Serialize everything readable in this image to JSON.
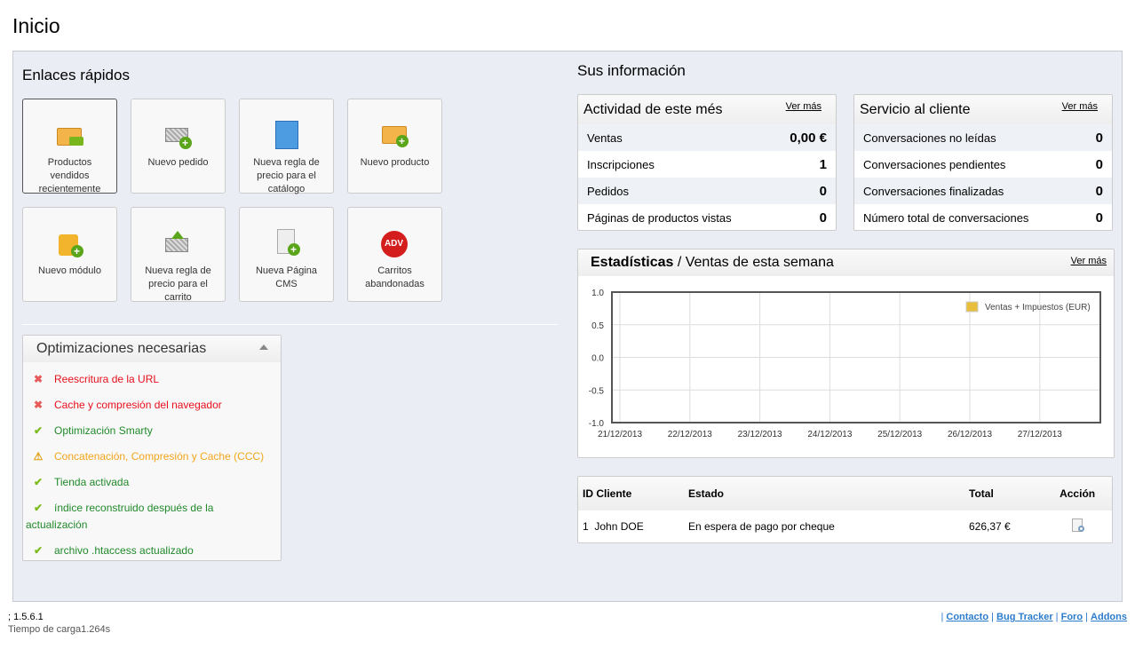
{
  "page_title": "Inicio",
  "quick_links": {
    "title": "Enlaces rápidos",
    "items": [
      {
        "label": "Productos vendidos recientemente",
        "icon": "box-arrow-icon"
      },
      {
        "label": "Nuevo pedido",
        "icon": "cart-add-icon"
      },
      {
        "label": "Nueva regla de precio para el catálogo",
        "icon": "book-icon"
      },
      {
        "label": "Nuevo producto",
        "icon": "box-add-icon"
      },
      {
        "label": "Nuevo módulo",
        "icon": "puzzle-add-icon"
      },
      {
        "label": "Nueva regla de precio para el carrito",
        "icon": "cart-up-icon"
      },
      {
        "label": "Nueva Página CMS",
        "icon": "page-add-icon"
      },
      {
        "label": "Carritos abandonadas",
        "icon": "adv-badge-icon",
        "badge": "ADV"
      }
    ]
  },
  "optimizations": {
    "title": "Optimizaciones necesarias",
    "items": [
      {
        "label": "Reescritura de la URL",
        "status": "error"
      },
      {
        "label": "Cache y compresión del navegador",
        "status": "error"
      },
      {
        "label": "Optimización Smarty",
        "status": "ok"
      },
      {
        "label": "Concatenación, Compresión y Cache (CCC)",
        "status": "warning"
      },
      {
        "label": "Tienda activada",
        "status": "ok"
      },
      {
        "label": "índice reconstruido después de la actualización",
        "status": "ok"
      },
      {
        "label": "archivo .htaccess actualizado",
        "status": "ok"
      }
    ]
  },
  "info": {
    "title": "Sus información",
    "activity": {
      "title": "Actividad de este més",
      "more": "Ver más",
      "rows": [
        {
          "label": "Ventas",
          "value": "0,00 €"
        },
        {
          "label": "Inscripciones",
          "value": "1"
        },
        {
          "label": "Pedidos",
          "value": "0"
        },
        {
          "label": "Páginas de productos vistas",
          "value": "0"
        }
      ]
    },
    "service": {
      "title": "Servicio al cliente",
      "more": "Ver más",
      "rows": [
        {
          "label": "Conversaciones no leídas",
          "value": "0"
        },
        {
          "label": "Conversaciones pendientes",
          "value": "0"
        },
        {
          "label": "Conversaciones finalizadas",
          "value": "0"
        },
        {
          "label": "Número total de conversaciones",
          "value": "0"
        }
      ]
    }
  },
  "stats": {
    "title_bold": "Estadísticas",
    "title_rest": " / Ventas de esta semana",
    "more": "Ver más"
  },
  "chart_data": {
    "type": "line",
    "title": "",
    "xlabel": "",
    "ylabel": "",
    "x_ticks": [
      "21/12/2013",
      "22/12/2013",
      "23/12/2013",
      "24/12/2013",
      "25/12/2013",
      "26/12/2013",
      "27/12/2013"
    ],
    "y_ticks": [
      "1.0",
      "0.5",
      "0.0",
      "-0.5",
      "-1.0"
    ],
    "ylim": [
      -1,
      1
    ],
    "grid": true,
    "legend": "top-right",
    "series": [
      {
        "name": "Ventas + Impuestos (EUR)",
        "color": "#e8bf3c",
        "values": []
      }
    ]
  },
  "orders": {
    "headers": [
      "ID Cliente",
      "Estado",
      "Total",
      "Acción"
    ],
    "rows": [
      {
        "id": "1",
        "customer": "John DOE",
        "status": "En espera de pago por cheque",
        "total": "626,37 €",
        "action_icon": "view-icon"
      }
    ]
  },
  "footer": {
    "version": "; 1.5.6.1",
    "load_time": "Tiempo de carga1.264s",
    "links": [
      "Contacto",
      "Bug Tracker",
      "Foro",
      "Addons"
    ]
  }
}
